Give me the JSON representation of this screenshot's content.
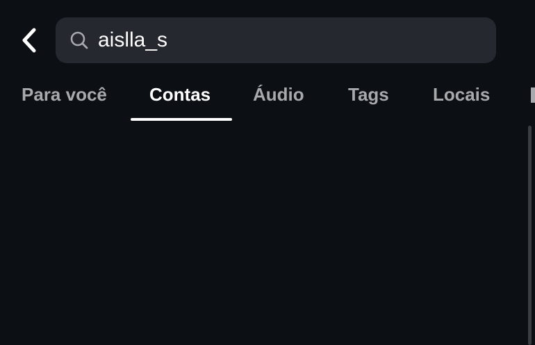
{
  "header": {
    "back_icon": "chevron-left-icon",
    "search": {
      "icon": "search-icon",
      "value": "aislla_s"
    }
  },
  "tabs": [
    {
      "label": "Para você",
      "active": false
    },
    {
      "label": "Contas",
      "active": true
    },
    {
      "label": "Áudio",
      "active": false
    },
    {
      "label": "Tags",
      "active": false
    },
    {
      "label": "Locais",
      "active": false
    }
  ],
  "colors": {
    "background": "#0c0f14",
    "search_bg": "#25282e",
    "active_tab": "#ffffff",
    "inactive_tab": "#a7a9ad"
  }
}
